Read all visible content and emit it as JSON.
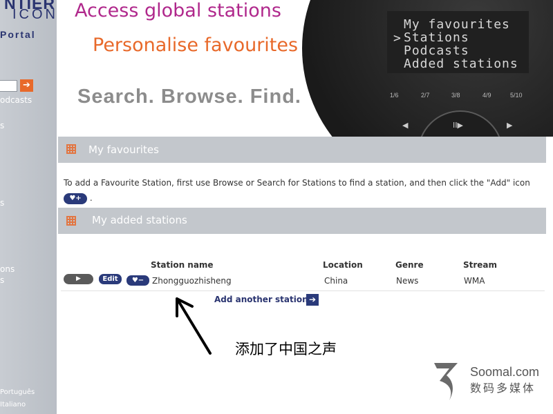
{
  "sidebar": {
    "brand_line1": "NTIER",
    "brand_line2": "ICON",
    "portal": "Portal",
    "go_arrow": "➔",
    "links": [
      "odcasts",
      "s",
      "s",
      "ons",
      "s"
    ],
    "languages": [
      "Português",
      "Italiano"
    ]
  },
  "header": {
    "tagline1": "Access global stations",
    "tagline2": "Personalise favourites",
    "tagline3": "Search. Browse. Find.",
    "device_menu": [
      "My favourites",
      "Stations",
      "Podcasts",
      "Added stations"
    ],
    "device_menu_selected_marker": ">",
    "presets": [
      "1/6",
      "2/7",
      "3/8",
      "4/9",
      "5/10"
    ],
    "controls": [
      "◀",
      "II▶",
      "▶"
    ]
  },
  "favourites": {
    "title": "My favourites",
    "info_text": "To add a Favourite Station, first use Browse or Search for Stations to find a station, and then    click the \"Add\" icon",
    "info_end": ".",
    "add_icon_label": "♥+"
  },
  "added_stations": {
    "title": "My added stations",
    "columns": {
      "name": "Station name",
      "location": "Location",
      "genre": "Genre",
      "stream": "Stream"
    },
    "rows": [
      {
        "play_label": "▶",
        "edit_label": "Edit",
        "remove_label": "♥−",
        "name": "Zhongguozhisheng",
        "location": "China",
        "genre": "News",
        "stream": "WMA"
      }
    ],
    "add_another": "Add another station",
    "add_arrow": "➔"
  },
  "annotation": "添加了中国之声",
  "watermark": {
    "line1": "Soomal.com",
    "line2": "数码多媒体"
  },
  "colors": {
    "accent_magenta": "#b0288c",
    "accent_orange": "#e8692a",
    "navy": "#2a3a7a",
    "bar_grey": "#c3c7cc"
  }
}
